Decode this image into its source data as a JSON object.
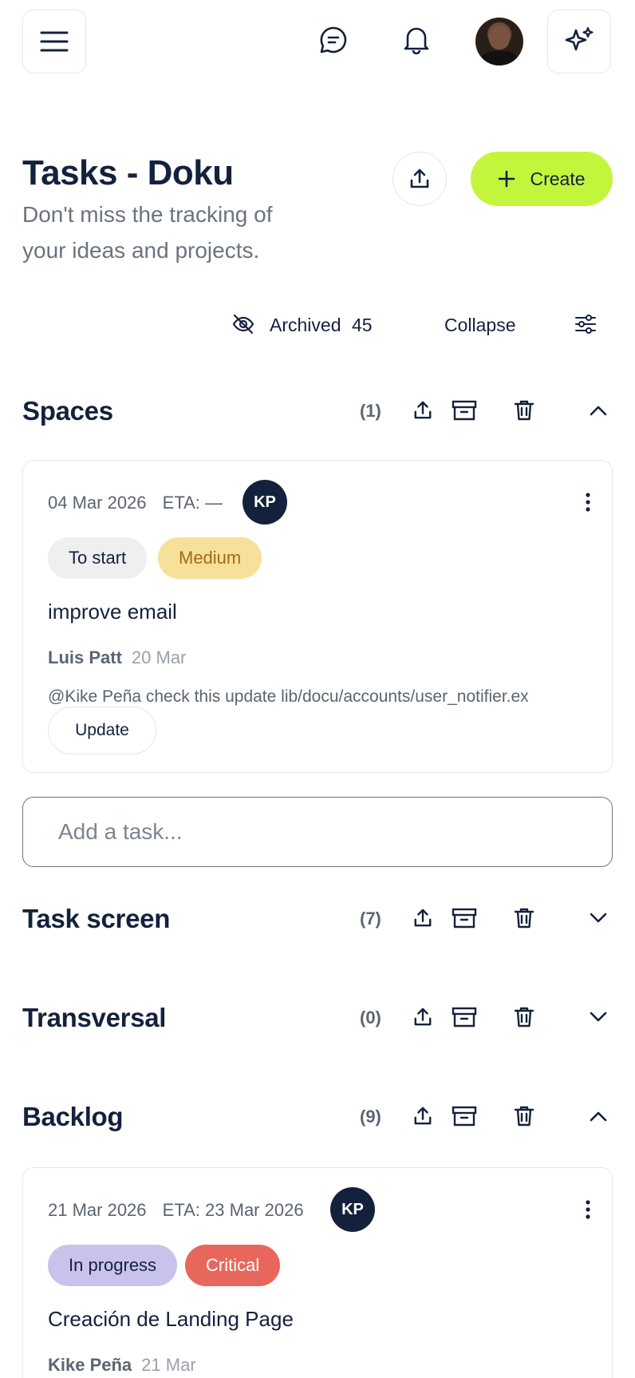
{
  "page": {
    "title": "Tasks - Doku",
    "subtitle": "Don't miss the tracking of your ideas and projects.",
    "create_label": "Create"
  },
  "filters": {
    "archived_label": "Archived",
    "archived_count": "45",
    "collapse_label": "Collapse"
  },
  "sections": [
    {
      "name": "Spaces",
      "count": "(1)",
      "expanded": true
    },
    {
      "name": "Task screen",
      "count": "(7)",
      "expanded": false
    },
    {
      "name": "Transversal",
      "count": "(0)",
      "expanded": false
    },
    {
      "name": "Backlog",
      "count": "(9)",
      "expanded": true
    }
  ],
  "cards": [
    {
      "date": "04 Mar 2026",
      "eta": "ETA: —",
      "assignee": "KP",
      "status": "To start",
      "priority": "Medium",
      "title": "improve email",
      "author": "Luis Patt",
      "author_date": "20 Mar",
      "comment": "@Kike Peña check this update lib/docu/accounts/user_notifier.ex",
      "action": "Update"
    },
    {
      "date": "21 Mar 2026",
      "eta": "ETA: 23 Mar 2026",
      "assignee": "KP",
      "status": "In progress",
      "priority": "Critical",
      "title": "Creación de Landing Page",
      "author": "Kike Peña",
      "author_date": "21 Mar"
    }
  ],
  "add_task": {
    "placeholder": "Add a task..."
  },
  "colors": {
    "accent": "#c3f53c",
    "navy": "#14213d",
    "status_to_start": "#efefef",
    "priority_medium": "#f7e09a",
    "status_in_progress": "#c9c3ec",
    "priority_critical": "#e8675c"
  },
  "icons": {
    "menu": "hamburger-menu-icon",
    "chat": "chat-bubble-icon",
    "notifications": "bell-icon",
    "ai": "sparkles-icon",
    "share": "share-upload-icon",
    "archived": "eye-off-icon",
    "filters": "sliders-icon",
    "archive": "archive-box-icon",
    "delete": "trash-icon",
    "expand": "chevron-icon",
    "more": "kebab-icon"
  }
}
